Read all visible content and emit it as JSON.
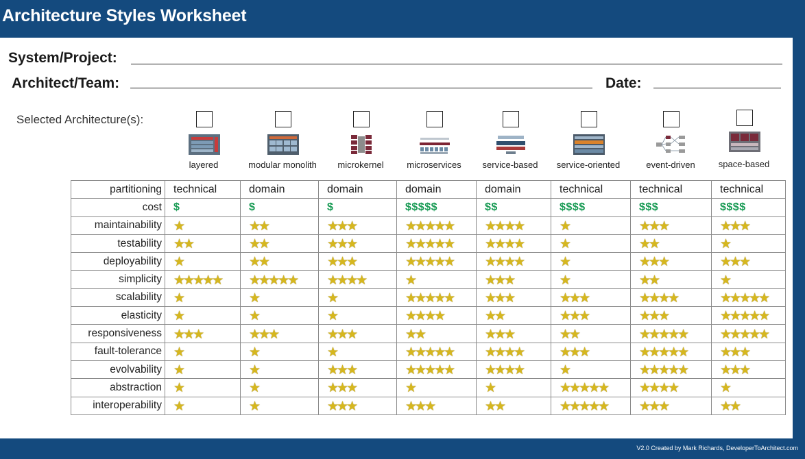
{
  "header": {
    "title": "Architecture Styles Worksheet"
  },
  "fields": {
    "system_label": "System/Project:",
    "architect_label": "Architect/Team:",
    "date_label": "Date:"
  },
  "selected_label": "Selected Architecture(s):",
  "architectures": [
    {
      "name": "layered",
      "icon": "layered-diagram-icon",
      "selected": false
    },
    {
      "name": "modular monolith",
      "icon": "modular-monolith-diagram-icon",
      "selected": false
    },
    {
      "name": "microkernel",
      "icon": "microkernel-diagram-icon",
      "selected": false
    },
    {
      "name": "microservices",
      "icon": "microservices-diagram-icon",
      "selected": false
    },
    {
      "name": "service-based",
      "icon": "service-based-diagram-icon",
      "selected": false
    },
    {
      "name": "service-oriented",
      "icon": "service-oriented-diagram-icon",
      "selected": false
    },
    {
      "name": "event-driven",
      "icon": "event-driven-diagram-icon",
      "selected": false
    },
    {
      "name": "space-based",
      "icon": "space-based-diagram-icon",
      "selected": false
    }
  ],
  "partitioning": {
    "label": "partitioning",
    "values": [
      "technical",
      "domain",
      "domain",
      "domain",
      "domain",
      "technical",
      "technical",
      "technical"
    ]
  },
  "cost": {
    "label": "cost",
    "values": [
      "$",
      "$",
      "$",
      "$$$$$",
      "$$",
      "$$$$",
      "$$$",
      "$$$$"
    ]
  },
  "ratings": [
    {
      "label": "maintainability",
      "values": [
        1,
        2,
        3,
        5,
        4,
        1,
        3,
        3
      ]
    },
    {
      "label": "testability",
      "values": [
        2,
        2,
        3,
        5,
        4,
        1,
        2,
        1
      ]
    },
    {
      "label": "deployability",
      "values": [
        1,
        2,
        3,
        5,
        4,
        1,
        3,
        3
      ]
    },
    {
      "label": "simplicity",
      "values": [
        5,
        5,
        4,
        1,
        3,
        1,
        2,
        1
      ]
    },
    {
      "label": "scalability",
      "values": [
        1,
        1,
        1,
        5,
        3,
        3,
        4,
        5
      ]
    },
    {
      "label": "elasticity",
      "values": [
        1,
        1,
        1,
        4,
        2,
        3,
        3,
        5
      ]
    },
    {
      "label": "responsiveness",
      "values": [
        3,
        3,
        3,
        2,
        3,
        2,
        5,
        5
      ]
    },
    {
      "label": "fault-tolerance",
      "values": [
        1,
        1,
        1,
        5,
        4,
        3,
        5,
        3
      ]
    },
    {
      "label": "evolvability",
      "values": [
        1,
        1,
        3,
        5,
        4,
        1,
        5,
        3
      ]
    },
    {
      "label": "abstraction",
      "values": [
        1,
        1,
        3,
        1,
        1,
        5,
        4,
        1
      ]
    },
    {
      "label": "interoperability",
      "values": [
        1,
        1,
        3,
        3,
        2,
        5,
        3,
        2
      ]
    }
  ],
  "colors": {
    "header": "#144a7e",
    "cost": "#179a53",
    "star": "#d6b71e"
  },
  "footer": {
    "credit": "V2.0 Created by Mark Richards, DeveloperToArchitect.com"
  }
}
